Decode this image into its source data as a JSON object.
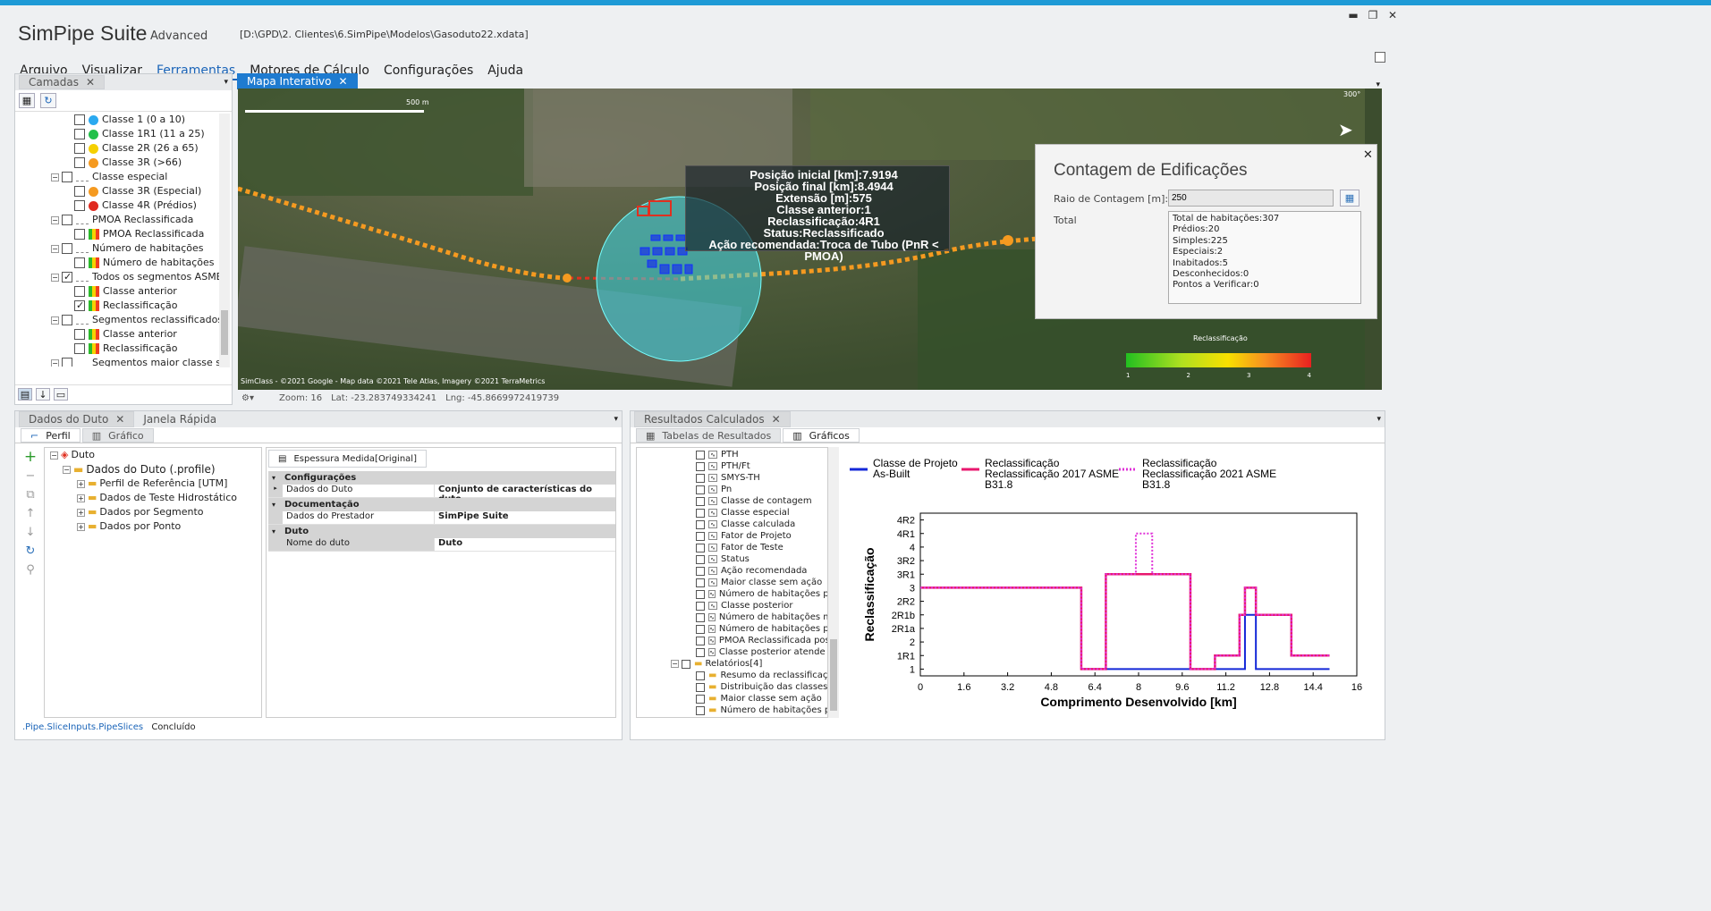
{
  "app": {
    "title": "SimPipe Suite",
    "edition": "Advanced",
    "filepath": "[D:\\GPD\\2. Clientes\\6.SimPipe\\Modelos\\Gasoduto22.xdata]"
  },
  "menu": [
    {
      "label": "Arquivo"
    },
    {
      "label": "Visualizar"
    },
    {
      "label": "Ferramentas"
    },
    {
      "label": "Motores de Cálculo"
    },
    {
      "label": "Configurações"
    },
    {
      "label": "Ajuda"
    }
  ],
  "layers": {
    "tab": "Camadas",
    "items": [
      {
        "label": "Classe 1 (0 a 10)",
        "color": "#2aa9f0"
      },
      {
        "label": "Classe 1R1 (11 a 25)",
        "color": "#22c04a"
      },
      {
        "label": "Classe 2R (26 a 65)",
        "color": "#f5d000"
      },
      {
        "label": "Classe 3R (>66)",
        "color": "#f59a20"
      },
      {
        "label": "Classe especial"
      },
      {
        "label": "Classe 3R (Especial)",
        "color": "#f59a20"
      },
      {
        "label": "Classe 4R (Prédios)",
        "color": "#e02a20"
      },
      {
        "label": "PMOA Reclassificada"
      },
      {
        "label": "PMOA Reclassificada"
      },
      {
        "label": "Número de habitações"
      },
      {
        "label": "Número de habitações"
      },
      {
        "label": "Todos os segmentos ASME"
      },
      {
        "label": "Classe anterior"
      },
      {
        "label": "Reclassificação"
      },
      {
        "label": "Segmentos reclassificados ASME"
      },
      {
        "label": "Classe anterior"
      },
      {
        "label": "Reclassificação"
      },
      {
        "label": "Segmentos maior classe sem ação"
      },
      {
        "label": "Classe anterior"
      },
      {
        "label": "Reclassificação"
      },
      {
        "label": "Maior classe sem ação"
      },
      {
        "label": "Segmentos classe posterior"
      }
    ]
  },
  "map": {
    "tab": "Mapa Interativo",
    "scale": "500 m",
    "heading": "300°",
    "info": [
      "Posição inicial [km]:7.9194",
      "Posição final [km]:8.4944",
      "Extensão [m]:575",
      "Classe anterior:1",
      "Reclassificação:4R1",
      "Status:Reclassificado",
      "Ação recomendada:Troca de Tubo (PnR < PMOA)"
    ],
    "attribution": "SimClass - ©2021 Google - Map data ©2021 Tele Atlas, Imagery ©2021 TerraMetrics",
    "legend_title": "Reclassificação",
    "legend_ticks": [
      "1",
      "2",
      "3",
      "4"
    ],
    "status": {
      "zoom": "Zoom: 16",
      "lat": "Lat: -23.283749334241",
      "lng": "Lng: -45.8669972419739"
    }
  },
  "count": {
    "title": "Contagem de Edificações",
    "radius_label": "Raio de Contagem [m]:",
    "radius_value": "250",
    "total_label": "Total",
    "lines": [
      "Total de habitações:307",
      "Prédios:20",
      "Simples:225",
      "Especiais:2",
      "Inabitados:5",
      "Desconhecidos:0",
      "Pontos a Verificar:0"
    ]
  },
  "duto": {
    "tabs": [
      "Dados do Duto",
      "Janela Rápida"
    ],
    "subtabs": [
      "Perfil",
      "Gráfico"
    ],
    "tree": [
      "Duto",
      "Dados do Duto (.profile)",
      "Perfil de Referência [UTM]",
      "Dados de Teste Hidrostático",
      "Dados por Segmento",
      "Dados por Ponto"
    ],
    "prop_tab": "Espessura Medida[Original]",
    "sections": [
      {
        "title": "Configurações",
        "rows": [
          [
            "Dados do Duto",
            "Conjunto de características do duto"
          ]
        ]
      },
      {
        "title": "Documentação",
        "rows": [
          [
            "Dados do Prestador",
            "SimPipe Suite"
          ]
        ]
      },
      {
        "title": "Duto",
        "rows": [
          [
            "Nome do duto",
            "Duto"
          ]
        ]
      }
    ],
    "status_link": ".Pipe.SliceInputs.PipeSlices",
    "status_text": "Concluído"
  },
  "results": {
    "tab": "Resultados Calculados",
    "subtabs": [
      "Tabelas de Resultados",
      "Gráficos"
    ],
    "items": [
      "PTH",
      "PTH/Ft",
      "SMYS-TH",
      "Pn",
      "Classe de contagem",
      "Classe especial",
      "Classe calculada",
      "Fator de Projeto",
      "Fator de Teste",
      "Status",
      "Ação recomendada",
      "Maior classe sem ação",
      "Número de habitações para",
      "Classe posterior",
      "Número de habitações mínir",
      "Número de habitações para",
      "PMOA Reclassificada posteri",
      "Classe posterior atende nor"
    ],
    "folder": "Relatórios[4]",
    "reports": [
      "Resumo da reclassificação",
      "Distribuição das classes",
      "Maior classe sem ação",
      "Número de habitações para"
    ]
  },
  "chart_data": {
    "type": "line",
    "xlabel": "Comprimento Desenvolvido [km]",
    "ylabel": "Reclassificação",
    "xlim": [
      0,
      16
    ],
    "xticks": [
      "0",
      "1.6",
      "3.2",
      "4.8",
      "6.4",
      "8",
      "9.6",
      "11.2",
      "12.8",
      "14.4",
      "16"
    ],
    "yticks": [
      "1",
      "1R1",
      "2",
      "2R1a",
      "2R1b",
      "2R2",
      "3",
      "3R1",
      "3R2",
      "4",
      "4R1",
      "4R2"
    ],
    "legend": [
      {
        "line1": "Classe de Projeto",
        "line2": "As-Built",
        "line3": ""
      },
      {
        "line1": "Reclassificação",
        "line2": "Reclassificação 2017 ASME",
        "line3": "B31.8"
      },
      {
        "line1": "Reclassificação",
        "line2": "Reclassificação 2021 ASME",
        "line3": "B31.8"
      }
    ],
    "series": [
      {
        "name": "Classe de Projeto As-Built",
        "color": "#1428d8",
        "style": "solid",
        "x": [
          0,
          5.9,
          5.9,
          11.9,
          11.9,
          12.3,
          12.3,
          15
        ],
        "y": [
          7,
          7,
          1,
          1,
          5,
          5,
          1,
          1
        ]
      },
      {
        "name": "Reclassificação 2017 ASME B31.8",
        "color": "#e8176e",
        "style": "solid",
        "x": [
          0,
          5.9,
          5.9,
          6.8,
          6.8,
          9.9,
          9.9,
          10.8,
          10.8,
          11.7,
          11.7,
          11.9,
          11.9,
          12.3,
          12.3,
          13.6,
          13.6,
          15
        ],
        "y": [
          7,
          7,
          1,
          1,
          8,
          8,
          1,
          1,
          2,
          2,
          5,
          5,
          7,
          7,
          5,
          5,
          2,
          2
        ]
      },
      {
        "name": "Reclassificação 2021 ASME B31.8",
        "color": "#e030d8",
        "style": "dotted",
        "x": [
          0,
          5.9,
          5.9,
          6.8,
          6.8,
          7.9,
          7.9,
          8.5,
          8.5,
          9.9,
          9.9,
          10.8,
          10.8,
          11.7,
          11.7,
          11.9,
          11.9,
          12.3,
          12.3,
          13.6,
          13.6,
          15
        ],
        "y": [
          7,
          7,
          1,
          1,
          8,
          8,
          11,
          11,
          8,
          8,
          1,
          1,
          2,
          2,
          5,
          5,
          7,
          7,
          5,
          5,
          2,
          2
        ]
      }
    ]
  }
}
